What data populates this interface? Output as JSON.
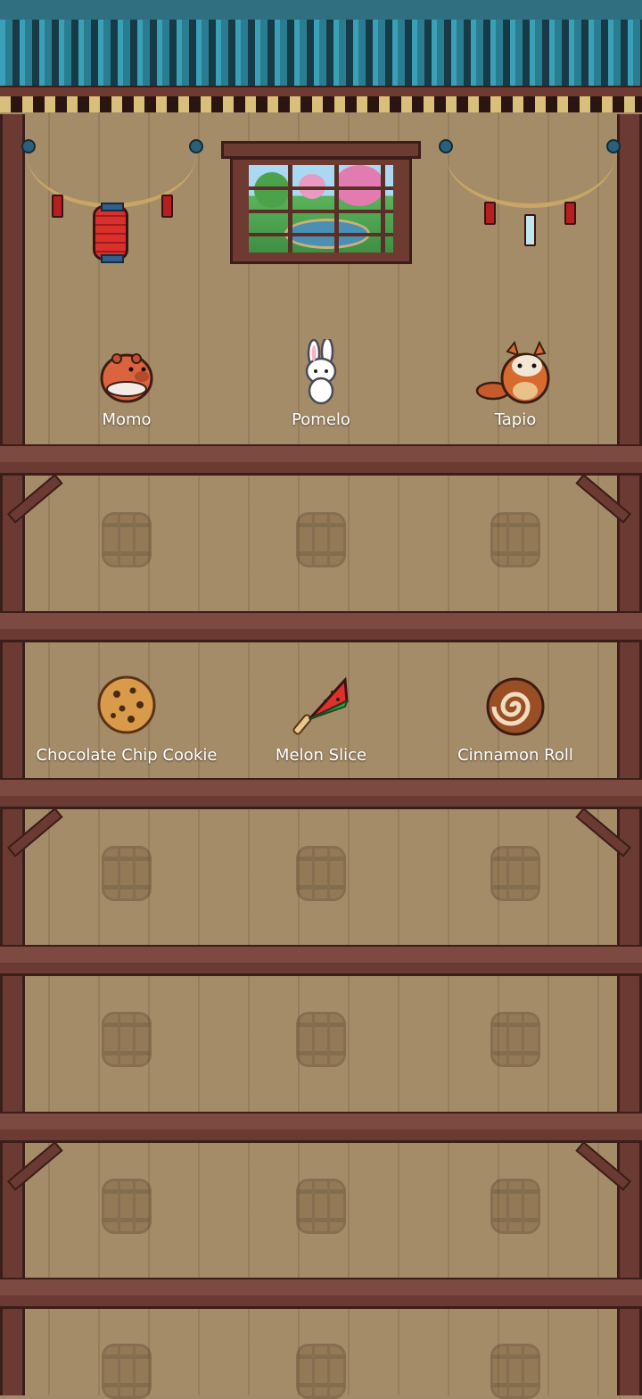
{
  "characters": [
    {
      "name": "Momo",
      "icon": "capybara-icon"
    },
    {
      "name": "Pomelo",
      "icon": "bunny-icon"
    },
    {
      "name": "Tapio",
      "icon": "red-panda-icon"
    }
  ],
  "foods": [
    {
      "name": "Chocolate Chip Cookie",
      "icon": "cookie-icon"
    },
    {
      "name": "Melon Slice",
      "icon": "watermelon-popsicle-icon"
    },
    {
      "name": "Cinnamon Roll",
      "icon": "cinnamon-roll-icon"
    }
  ],
  "empty_slot_icon": "barrel-icon",
  "colors": {
    "wall": "#a58c69",
    "wood": "#6b3a33",
    "roof_tile": "#3aa0b7",
    "label": "#ffffff"
  }
}
